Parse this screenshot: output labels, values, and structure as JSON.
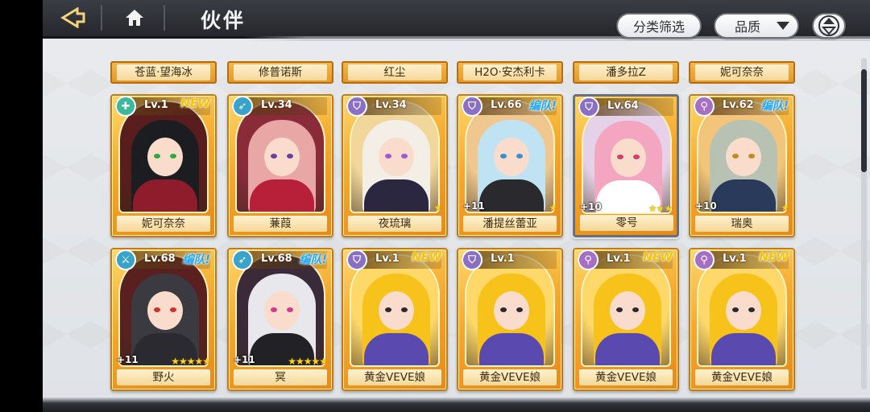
{
  "header": {
    "title": "伙伴",
    "back_icon": "back-arrow-icon",
    "home_icon": "home-icon",
    "filter_label": "分类筛选",
    "quality_label": "品质",
    "sort_icon": "sort-toggle-icon"
  },
  "top_row": [
    {
      "name": "苍蓝·望海冰"
    },
    {
      "name": "修普诺斯"
    },
    {
      "name": "红尘"
    },
    {
      "name": "H2O·安杰利卡"
    },
    {
      "name": "潘多拉Z"
    },
    {
      "name": "妮可奈奈"
    }
  ],
  "cards": [
    {
      "name": "妮可奈奈",
      "level": "Lv.1",
      "tag": "NEW",
      "tag_type": "new",
      "plus": "",
      "stars": "",
      "class_icon": "support-cross-icon",
      "class_color": "#3cb89b",
      "hair": "#1b1d20",
      "bg": "#5a1d1d",
      "eye": "#2cab3c",
      "outfit": "#8e1c2a",
      "selected": false
    },
    {
      "name": "蒹葭",
      "level": "Lv.34",
      "tag": "",
      "tag_type": "",
      "plus": "",
      "stars": "",
      "class_icon": "archer-bow-icon",
      "class_color": "#3aa3c9",
      "hair": "#e8a7a4",
      "bg": "#8a2b3a",
      "eye": "#6a3ea6",
      "outfit": "#b8203a",
      "selected": false
    },
    {
      "name": "夜琉璃",
      "level": "Lv.34",
      "tag": "",
      "tag_type": "",
      "plus": "",
      "stars": "★",
      "class_icon": "defender-shield-icon",
      "class_color": "#8a6fc4",
      "hair": "#f3efe6",
      "bg": "#f1d79a",
      "eye": "#a05ad0",
      "outfit": "#2b2740",
      "selected": false
    },
    {
      "name": "潘提丝蕾亚",
      "level": "Lv.66",
      "tag": "编队!",
      "tag_type": "team",
      "plus": "+11",
      "stars": "★",
      "class_icon": "defender-shield-icon",
      "class_color": "#8a6fc4",
      "hair": "#bfe3f3",
      "bg": "#f0c88f",
      "eye": "#3a8fd0",
      "outfit": "#2a2a2e",
      "selected": false
    },
    {
      "name": "零号",
      "level": "Lv.64",
      "tag": "",
      "tag_type": "",
      "plus": "+10",
      "stars": "★★★",
      "class_icon": "defender-shield-icon",
      "class_color": "#8a6fc4",
      "hair": "#f4a6c0",
      "bg": "#e5d2e8",
      "eye": "#d0406a",
      "outfit": "#ffffff",
      "selected": true
    },
    {
      "name": "瑞奥",
      "level": "Lv.62",
      "tag": "编队!",
      "tag_type": "team",
      "plus": "+10",
      "stars": "★",
      "class_icon": "mage-orb-icon",
      "class_color": "#a76fc4",
      "hair": "#b8c2b3",
      "bg": "#f2c57a",
      "eye": "#c58a1e",
      "outfit": "#2a3a5a",
      "selected": false
    },
    {
      "name": "野火",
      "level": "Lv.68",
      "tag": "编队!",
      "tag_type": "team",
      "plus": "+11",
      "stars": "★★★★★",
      "class_icon": "attacker-blade-icon",
      "class_color": "#3aa3c9",
      "hair": "#3a3a40",
      "bg": "#5a2020",
      "eye": "#d0302a",
      "outfit": "#2a2a30",
      "selected": false
    },
    {
      "name": "冥",
      "level": "Lv.68",
      "tag": "编队!",
      "tag_type": "team",
      "plus": "+11",
      "stars": "★★★★★",
      "class_icon": "archer-bow-icon",
      "class_color": "#3aa3c9",
      "hair": "#e7e7ec",
      "bg": "#3a2a3a",
      "eye": "#d03a8a",
      "outfit": "#222226",
      "selected": false
    },
    {
      "name": "黄金VEVE娘",
      "level": "Lv.1",
      "tag": "NEW",
      "tag_type": "new",
      "plus": "",
      "stars": "",
      "class_icon": "defender-shield-icon",
      "class_color": "#8a6fc4",
      "hair": "#f7c21a",
      "bg": "#ffd86a",
      "eye": "#2a2a2a",
      "outfit": "#5a4ab0",
      "selected": false
    },
    {
      "name": "黄金VEVE娘",
      "level": "Lv.1",
      "tag": "",
      "tag_type": "",
      "plus": "",
      "stars": "",
      "class_icon": "defender-shield-icon",
      "class_color": "#8a6fc4",
      "hair": "#f7c21a",
      "bg": "#ffd86a",
      "eye": "#2a2a2a",
      "outfit": "#5a4ab0",
      "selected": false
    },
    {
      "name": "黄金VEVE娘",
      "level": "Lv.1",
      "tag": "NEW",
      "tag_type": "new",
      "plus": "",
      "stars": "",
      "class_icon": "mage-orb-icon",
      "class_color": "#a76fc4",
      "hair": "#f7c21a",
      "bg": "#ffd86a",
      "eye": "#2a2a2a",
      "outfit": "#5a4ab0",
      "selected": false
    },
    {
      "name": "黄金VEVE娘",
      "level": "Lv.1",
      "tag": "NEW",
      "tag_type": "new",
      "plus": "",
      "stars": "",
      "class_icon": "mage-orb-icon",
      "class_color": "#a76fc4",
      "hair": "#f7c21a",
      "bg": "#ffd86a",
      "eye": "#2a2a2a",
      "outfit": "#5a4ab0",
      "selected": false
    }
  ]
}
